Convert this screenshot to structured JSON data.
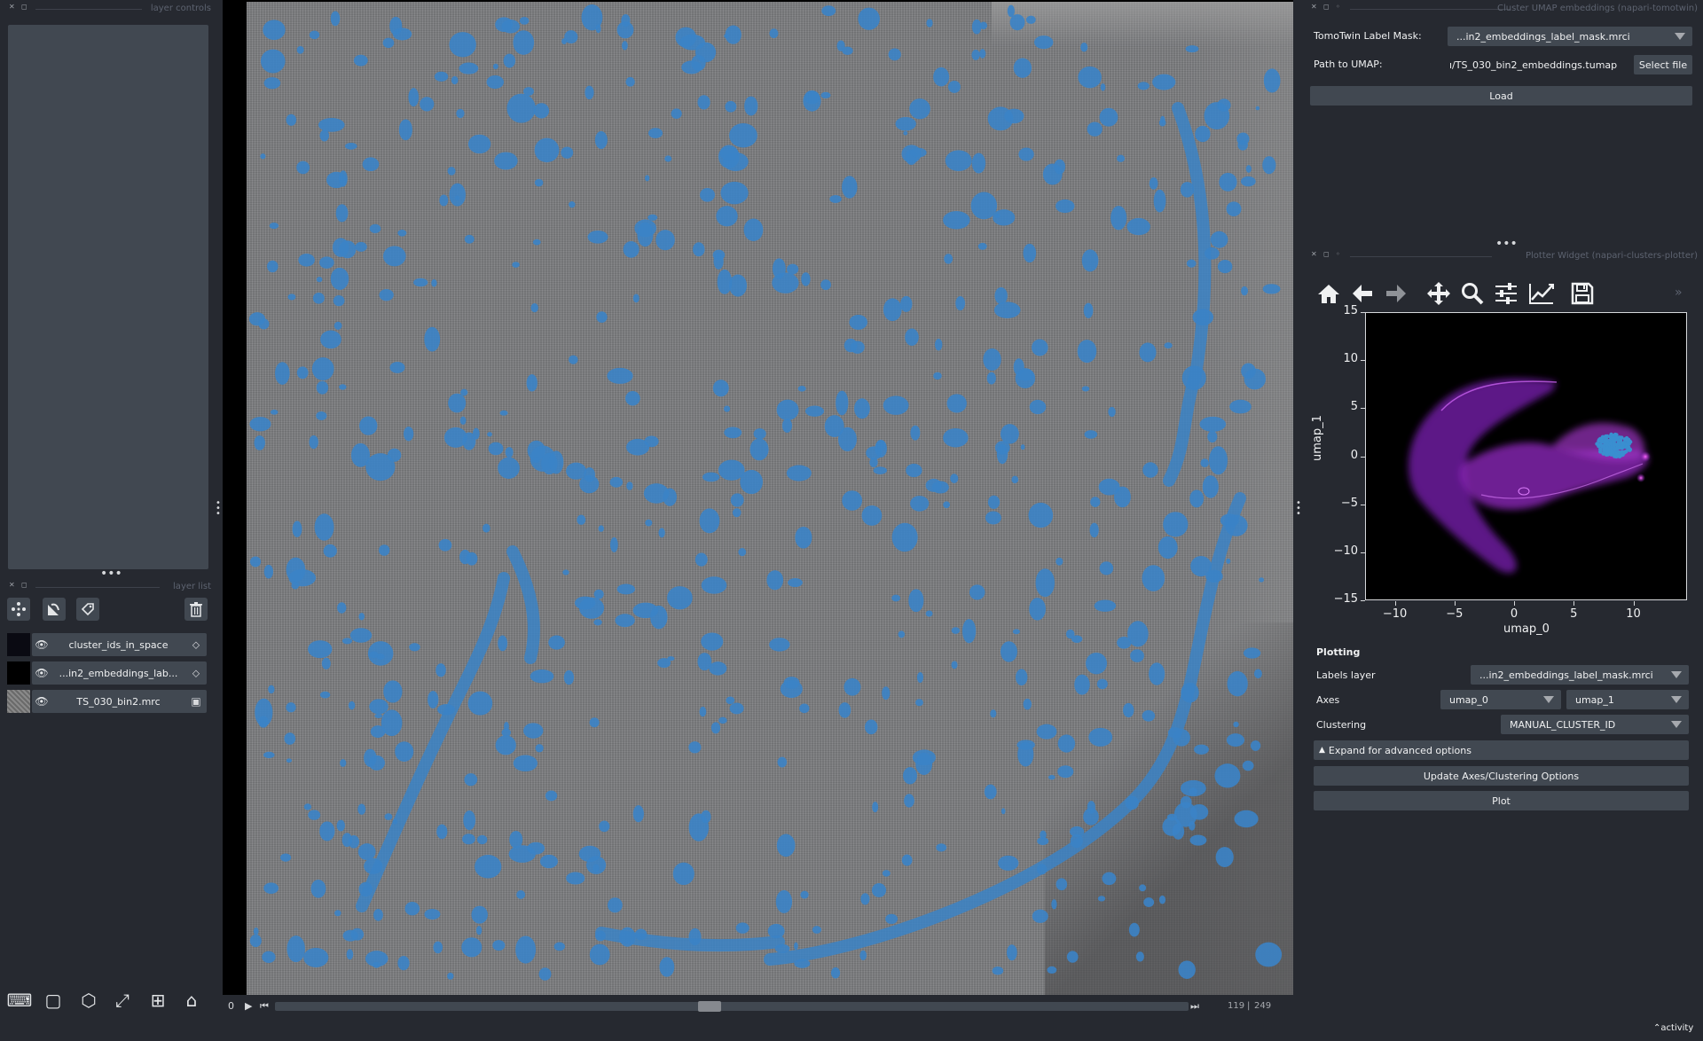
{
  "left_panel": {
    "layer_controls_title": "layer controls",
    "layer_list_title": "layer list",
    "layers": [
      {
        "name": "cluster_ids_in_space",
        "type_icon": "label-icon"
      },
      {
        "name": "...in2_embeddings_lab...",
        "type_icon": "label-icon"
      },
      {
        "name": "TS_030_bin2.mrc",
        "type_icon": "image-icon"
      }
    ],
    "layer_tools": [
      "points-layer-icon",
      "shapes-layer-icon",
      "labels-layer-icon",
      "delete-layer-icon"
    ],
    "bottom_tools": [
      "console-icon",
      "ndisplay-icon",
      "3d-icon",
      "transpose-icon",
      "grid-icon",
      "home-icon"
    ]
  },
  "canvas": {
    "colors": {
      "mask": "#3b83c6",
      "background": "#7c7d80"
    }
  },
  "dims_slider": {
    "axis_label": "0",
    "current": "119",
    "separator": "|",
    "total": "249"
  },
  "status": {
    "activity": "activity"
  },
  "umap_widget": {
    "title": "Cluster UMAP embeddings (napari-tomotwin)",
    "label_mask_label": "TomoTwin Label Mask:",
    "label_mask_value": "...in2_embeddings_label_mask.mrci",
    "path_label": "Path to UMAP:",
    "path_value": "ı/TS_030_bin2_embeddings.tumap",
    "select_file": "Select file",
    "load": "Load"
  },
  "plotter_widget": {
    "title": "Plotter Widget (napari-clusters-plotter)",
    "toolbar": [
      "home-icon",
      "back-icon",
      "forward-icon",
      "pan-icon",
      "zoom-icon",
      "configure-icon",
      "edit-axis-icon",
      "save-icon"
    ],
    "more": "»",
    "plotting_header": "Plotting",
    "labels_layer_label": "Labels layer",
    "labels_layer_value": "...in2_embeddings_label_mask.mrci",
    "axes_label": "Axes",
    "axis_x_value": "umap_0",
    "axis_y_value": "umap_1",
    "clustering_label": "Clustering",
    "clustering_value": "MANUAL_CLUSTER_ID",
    "advanced": "Expand for advanced options",
    "update_button": "Update Axes/Clustering Options",
    "plot_button": "Plot"
  },
  "chart_data": {
    "type": "scatter",
    "title": "",
    "xlabel": "umap_0",
    "ylabel": "umap_1",
    "xlim": [
      -12.5,
      14.5
    ],
    "ylim": [
      -15,
      15
    ],
    "xticks": [
      "−10",
      "−5",
      "0",
      "5",
      "10"
    ],
    "xtick_values": [
      -10,
      -5,
      0,
      5,
      10
    ],
    "yticks": [
      "15",
      "10",
      "5",
      "0",
      "−5",
      "−10",
      "−15"
    ],
    "ytick_values": [
      15,
      10,
      5,
      0,
      -5,
      -10,
      -15
    ],
    "colors": {
      "density": "#9b2fc9",
      "selected": "#3a8fd0"
    },
    "selected_cluster_center": [
      8.3,
      1.2
    ],
    "grid": false,
    "legend": "none"
  }
}
